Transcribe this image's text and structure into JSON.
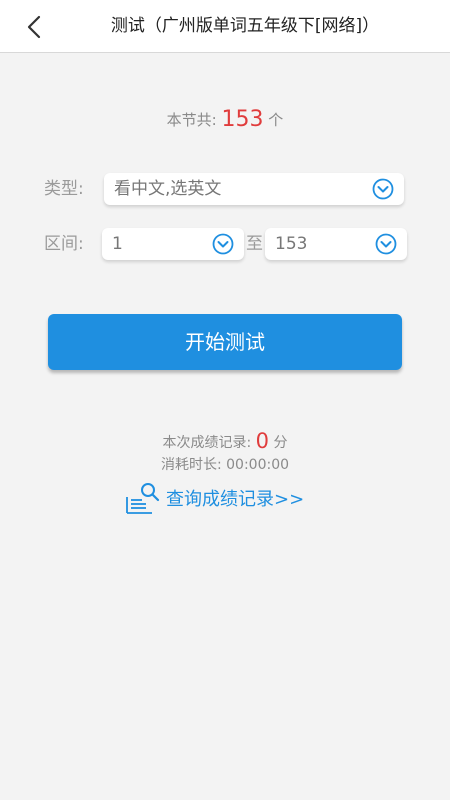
{
  "header": {
    "title": "测试（广州版单词五年级下[网络]）"
  },
  "summary": {
    "prefix": "本节共:",
    "count": "153",
    "suffix": "个"
  },
  "type_field": {
    "label": "类型:",
    "value": "看中文,选英文"
  },
  "range_field": {
    "label": "区间:",
    "from_value": "1",
    "separator": "至",
    "to_value": "153"
  },
  "start_button": {
    "label": "开始测试"
  },
  "score": {
    "prefix": "本次成绩记录:",
    "value": "0",
    "suffix": "分"
  },
  "elapsed": {
    "label": "消耗时长:",
    "value": "00:00:00"
  },
  "records_link": {
    "label": "查询成绩记录>>"
  },
  "colors": {
    "accent": "#1f8fe0",
    "highlight": "#e03c3c",
    "background": "#f3f3f3",
    "muted_text": "#8a8a8a"
  },
  "icons": {
    "back": "chevron-left-icon",
    "dropdown": "chevron-down-circle-icon",
    "records": "search-document-icon"
  }
}
